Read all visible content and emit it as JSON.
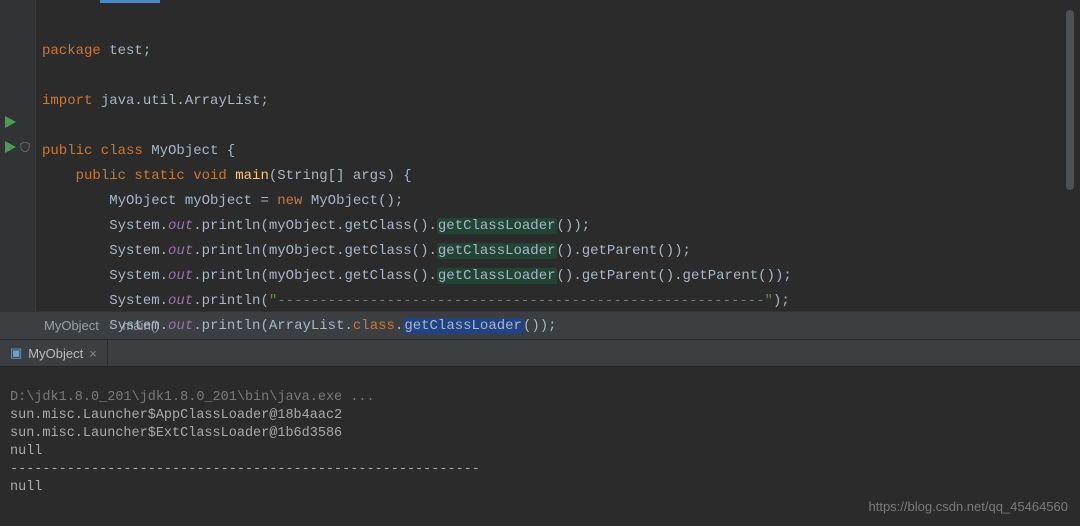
{
  "code": {
    "l1_kw": "package",
    "l1_rest": " test;",
    "l3_kw": "import",
    "l3_rest": " java.util.ArrayList;",
    "l5_kw1": "public class",
    "l5_cls": " MyObject ",
    "l5_brace": "{",
    "l6_ind": "    ",
    "l6_kw": "public static void",
    "l6_sp": " ",
    "l6_fn": "main",
    "l6_args": "(String[] args) {",
    "l7_ind": "        ",
    "l7_a": "MyObject myObject = ",
    "l7_kw": "new",
    "l7_b": " MyObject();",
    "l8_ind": "        ",
    "l8_sys": "System.",
    "l8_out": "out",
    "l8_p": ".println(myObject.getClass().",
    "l8_hl": "getClassLoader",
    "l8_tail": "());",
    "l9_ind": "        ",
    "l9_sys": "System.",
    "l9_out": "out",
    "l9_p": ".println(myObject.getClass().",
    "l9_hl": "getClassLoader",
    "l9_mid": "().getParent());",
    "l10_ind": "        ",
    "l10_sys": "System.",
    "l10_out": "out",
    "l10_p": ".println(myObject.getClass().",
    "l10_hl": "getClassLoader",
    "l10_tail": "().getParent().getParent());",
    "l11_ind": "        ",
    "l11_sys": "System.",
    "l11_out": "out",
    "l11_p1": ".println(",
    "l11_str": "\"----------------------------------------------------------\"",
    "l11_p2": ");",
    "l12_ind": "        ",
    "l12_sys": "System.",
    "l12_out": "out",
    "l12_p": ".println(ArrayList.",
    "l12_kw": "class",
    "l12_dot": ".",
    "l12_hl": "getClassLoader",
    "l12_tail": "());"
  },
  "breadcrumb": {
    "item1": "MyObject",
    "item2": "main()"
  },
  "run_tab": {
    "label": "MyObject"
  },
  "console": {
    "line1": "D:\\jdk1.8.0_201\\jdk1.8.0_201\\bin\\java.exe ...",
    "line2": "sun.misc.Launcher$AppClassLoader@18b4aac2",
    "line3": "sun.misc.Launcher$ExtClassLoader@1b6d3586",
    "line4": "null",
    "line5": "----------------------------------------------------------",
    "line6": "null"
  },
  "watermark": "https://blog.csdn.net/qq_45464560"
}
